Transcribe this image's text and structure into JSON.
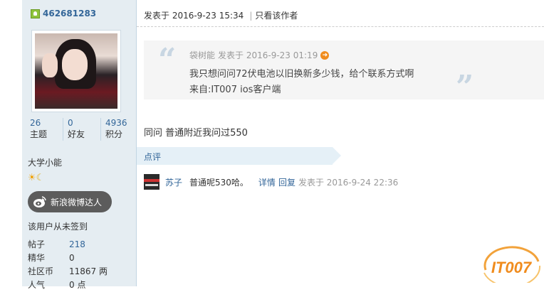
{
  "user": {
    "username": "462681283",
    "stats": [
      {
        "value": "26",
        "label": "主题"
      },
      {
        "value": "0",
        "label": "好友"
      },
      {
        "value": "4936",
        "label": "积分"
      }
    ],
    "title": "大学小能",
    "weibo_badge": "新浪微博达人",
    "sign_status": "该用户从未签到",
    "info": [
      {
        "key": "帖子",
        "value": "218"
      },
      {
        "key": "精华",
        "value": "0"
      },
      {
        "key": "社区币",
        "value": "11867 两"
      },
      {
        "key": "人气",
        "value": "0 点"
      }
    ]
  },
  "post": {
    "posted_at": "发表于 2016-9-23 15:34",
    "author_only": "只看该作者",
    "quote": {
      "author": "袋树能",
      "time": "发表于 2016-9-23 01:19",
      "line1": "我只想问问72伏电池以旧换新多少钱，给个联系方式啊",
      "line2": "来自:IT007 ios客户端"
    },
    "reply": "同问 普通附近我问过550"
  },
  "comments": {
    "label": "点评",
    "items": [
      {
        "user": "苏子",
        "text": "普通呢530哈。",
        "detail": "详情",
        "reply": "回复",
        "time": "发表于 2016-9-24 22:36"
      }
    ]
  },
  "watermark": "IT007",
  "colors": {
    "link": "#336699",
    "sidebar_bg": "#e5edf2",
    "accent_orange": "#f08c1e"
  }
}
